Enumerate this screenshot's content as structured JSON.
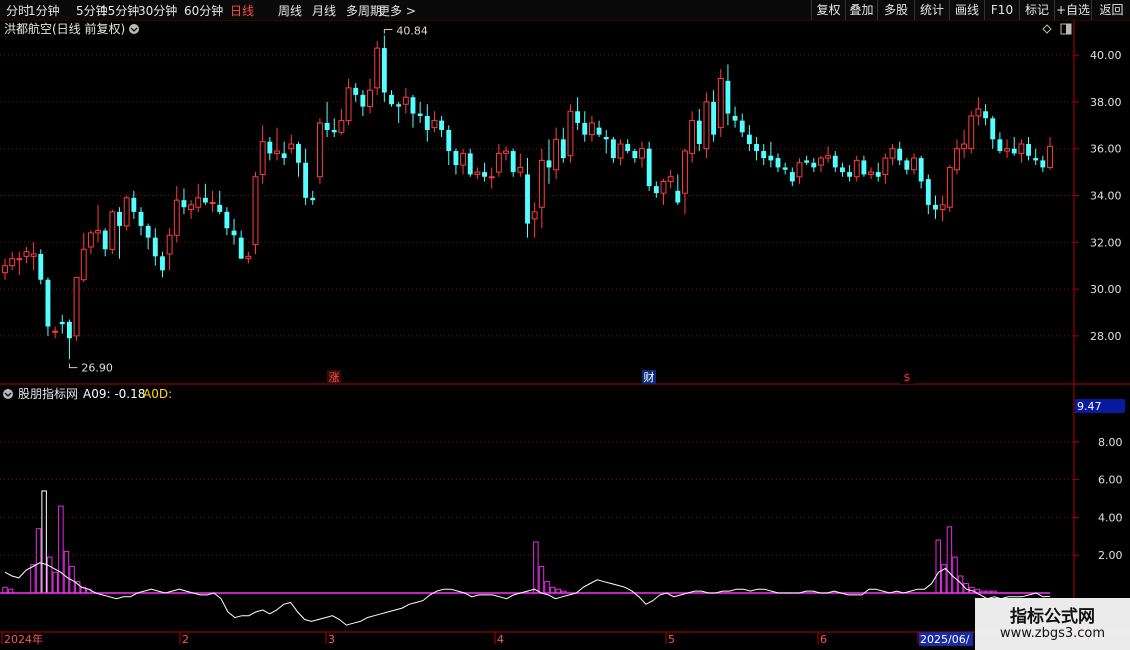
{
  "toolbar": {
    "periods": [
      "分时",
      "1分钟",
      "5分钟",
      "15分钟",
      "30分钟",
      "60分钟",
      "日线",
      "周线",
      "月线",
      "多周期",
      "更多 >"
    ],
    "active_period": "日线",
    "right_buttons": [
      "复权",
      "叠加",
      "多股",
      "统计",
      "画线",
      "F10",
      "标记",
      "+自选",
      "返回"
    ]
  },
  "chart_title": "洪都航空(日线 前复权)",
  "indicator_title": "股朋指标网",
  "indicator_readout_a09": "A09: -0.18",
  "indicator_readout_a0d": "A0D:",
  "indicator_current_label": "9.47",
  "price_max_label": "40.84",
  "price_min_label": "26.90",
  "events": {
    "zhang": "涨",
    "cai": "财",
    "dollar": "$"
  },
  "x_labels": [
    "2024年",
    "2",
    "3",
    "4",
    "5",
    "6",
    "2025/06/"
  ],
  "watermark": {
    "line1": "指标公式网",
    "line2": "www.zbgs3.com"
  },
  "colors": {
    "up": "#ff3c3c",
    "down": "#54ffff",
    "grid": "#7a1010",
    "axis": "#b40000",
    "line": "#ffffff",
    "bars": "#e030e0",
    "baseline": "#ff30ff"
  },
  "chart_data": [
    {
      "type": "candlestick",
      "title": "洪都航空(日线 前复权)",
      "y_ticks": [
        28,
        30,
        32,
        34,
        36,
        38,
        40
      ],
      "ylim": [
        27,
        41.5
      ],
      "max_label": 40.84,
      "min_label": 26.9,
      "candles": [
        [
          30.7,
          31.3,
          30.4,
          31.0
        ],
        [
          31.0,
          31.6,
          30.8,
          31.3
        ],
        [
          31.3,
          31.6,
          30.6,
          31.3
        ],
        [
          31.4,
          31.8,
          31.1,
          31.6
        ],
        [
          31.4,
          32.0,
          30.8,
          31.5
        ],
        [
          31.5,
          31.7,
          30.2,
          30.4
        ],
        [
          30.4,
          30.5,
          28.0,
          28.4
        ],
        [
          28.2,
          28.4,
          27.9,
          28.2
        ],
        [
          28.6,
          28.9,
          28.1,
          28.5
        ],
        [
          28.6,
          28.7,
          27.0,
          27.9
        ],
        [
          28.0,
          30.5,
          27.8,
          30.5
        ],
        [
          30.4,
          32.4,
          30.3,
          31.7
        ],
        [
          31.8,
          32.5,
          31.5,
          32.4
        ],
        [
          32.4,
          33.6,
          32.0,
          32.5
        ],
        [
          32.5,
          32.6,
          31.4,
          31.7
        ],
        [
          31.7,
          33.4,
          31.5,
          33.3
        ],
        [
          33.3,
          33.5,
          31.3,
          32.7
        ],
        [
          32.7,
          34.0,
          32.5,
          33.9
        ],
        [
          33.9,
          34.2,
          33.0,
          33.3
        ],
        [
          33.3,
          33.5,
          32.3,
          32.7
        ],
        [
          32.7,
          32.8,
          31.7,
          32.2
        ],
        [
          32.2,
          32.6,
          31.0,
          31.4
        ],
        [
          31.4,
          31.6,
          30.5,
          30.8
        ],
        [
          31.5,
          32.6,
          30.8,
          32.3
        ],
        [
          32.3,
          34.4,
          32.0,
          33.8
        ],
        [
          33.8,
          34.3,
          33.2,
          33.5
        ],
        [
          33.4,
          33.8,
          33.0,
          33.6
        ],
        [
          33.5,
          34.5,
          33.3,
          33.9
        ],
        [
          33.9,
          34.5,
          33.6,
          33.7
        ],
        [
          33.7,
          34.2,
          33.3,
          33.7
        ],
        [
          33.6,
          34.2,
          33.2,
          33.3
        ],
        [
          33.3,
          33.5,
          32.3,
          32.6
        ],
        [
          32.5,
          33.0,
          31.9,
          32.3
        ],
        [
          32.2,
          32.5,
          31.3,
          31.3
        ],
        [
          31.3,
          31.6,
          31.1,
          31.4
        ],
        [
          31.9,
          35.0,
          31.5,
          34.8
        ],
        [
          34.9,
          37.0,
          34.5,
          36.3
        ],
        [
          36.3,
          36.5,
          35.5,
          35.8
        ],
        [
          35.8,
          36.9,
          35.5,
          35.9
        ],
        [
          35.8,
          36.3,
          35.3,
          35.6
        ],
        [
          36.0,
          36.6,
          35.8,
          36.2
        ],
        [
          36.2,
          36.3,
          34.8,
          35.4
        ],
        [
          35.4,
          36.0,
          33.6,
          33.9
        ],
        [
          33.9,
          34.2,
          33.6,
          33.8
        ],
        [
          34.8,
          37.3,
          34.5,
          37.1
        ],
        [
          37.1,
          38.0,
          36.5,
          36.8
        ],
        [
          36.8,
          37.3,
          36.5,
          36.7
        ],
        [
          36.7,
          37.7,
          36.6,
          37.2
        ],
        [
          37.2,
          39.0,
          37.0,
          38.6
        ],
        [
          38.6,
          38.8,
          38.0,
          38.3
        ],
        [
          38.3,
          38.5,
          37.4,
          37.8
        ],
        [
          37.8,
          39.0,
          37.5,
          38.5
        ],
        [
          38.6,
          40.6,
          38.3,
          40.3
        ],
        [
          40.3,
          40.84,
          38.0,
          38.4
        ],
        [
          38.3,
          38.5,
          37.8,
          37.9
        ],
        [
          37.9,
          38.0,
          37.1,
          37.8
        ],
        [
          37.9,
          38.6,
          37.5,
          38.2
        ],
        [
          38.2,
          38.3,
          36.9,
          37.5
        ],
        [
          37.5,
          38.0,
          37.1,
          37.4
        ],
        [
          37.4,
          37.9,
          36.3,
          36.8
        ],
        [
          36.9,
          37.6,
          36.7,
          37.2
        ],
        [
          37.2,
          37.4,
          36.5,
          36.8
        ],
        [
          36.8,
          37.0,
          35.3,
          35.9
        ],
        [
          35.9,
          36.0,
          34.9,
          35.3
        ],
        [
          35.3,
          36.0,
          34.9,
          35.8
        ],
        [
          35.8,
          36.0,
          34.8,
          34.9
        ],
        [
          34.9,
          35.2,
          34.7,
          35.0
        ],
        [
          35.0,
          35.4,
          34.6,
          34.8
        ],
        [
          34.8,
          35.2,
          34.3,
          34.8
        ],
        [
          35.0,
          36.2,
          34.8,
          35.8
        ],
        [
          35.8,
          36.1,
          35.5,
          35.9
        ],
        [
          35.9,
          36.0,
          34.8,
          35.0
        ],
        [
          35.0,
          35.8,
          34.8,
          35.2
        ],
        [
          34.9,
          35.6,
          32.2,
          32.8
        ],
        [
          33.0,
          33.7,
          32.2,
          33.3
        ],
        [
          33.5,
          36.0,
          32.6,
          35.5
        ],
        [
          35.5,
          36.4,
          34.5,
          35.2
        ],
        [
          35.1,
          36.9,
          34.7,
          36.4
        ],
        [
          36.4,
          36.9,
          35.4,
          35.6
        ],
        [
          35.7,
          37.9,
          35.4,
          37.6
        ],
        [
          37.6,
          38.2,
          36.8,
          37.1
        ],
        [
          37.1,
          37.6,
          36.3,
          36.6
        ],
        [
          36.6,
          37.4,
          36.3,
          37.1
        ],
        [
          36.9,
          37.2,
          36.5,
          36.6
        ],
        [
          36.5,
          36.8,
          35.8,
          36.4
        ],
        [
          36.4,
          36.5,
          35.4,
          35.6
        ],
        [
          35.6,
          36.4,
          35.3,
          36.2
        ],
        [
          36.2,
          36.4,
          35.8,
          35.9
        ],
        [
          35.9,
          36.0,
          35.4,
          35.6
        ],
        [
          35.6,
          36.3,
          35.2,
          36.0
        ],
        [
          36.0,
          36.3,
          34.2,
          34.4
        ],
        [
          34.4,
          34.6,
          33.9,
          34.1
        ],
        [
          34.1,
          34.7,
          33.6,
          34.6
        ],
        [
          34.6,
          35.1,
          34.3,
          34.8
        ],
        [
          34.2,
          34.9,
          33.6,
          33.7
        ],
        [
          34.1,
          36.0,
          33.2,
          35.9
        ],
        [
          35.8,
          37.6,
          35.4,
          37.2
        ],
        [
          37.2,
          37.7,
          35.9,
          36.2
        ],
        [
          36.0,
          38.4,
          35.6,
          38.0
        ],
        [
          38.0,
          38.5,
          36.3,
          36.6
        ],
        [
          36.9,
          39.4,
          36.5,
          39.0
        ],
        [
          38.9,
          39.6,
          37.0,
          37.5
        ],
        [
          37.4,
          37.8,
          36.9,
          37.2
        ],
        [
          37.2,
          37.5,
          36.5,
          36.7
        ],
        [
          36.6,
          37.0,
          35.9,
          36.2
        ],
        [
          36.2,
          36.5,
          35.5,
          35.9
        ],
        [
          35.9,
          36.2,
          35.3,
          35.6
        ],
        [
          35.7,
          36.3,
          35.2,
          35.5
        ],
        [
          35.6,
          35.8,
          35.0,
          35.2
        ],
        [
          35.2,
          35.4,
          34.9,
          35.1
        ],
        [
          35.0,
          35.2,
          34.4,
          34.6
        ],
        [
          34.8,
          35.6,
          34.5,
          35.4
        ],
        [
          35.5,
          35.7,
          35.3,
          35.4
        ],
        [
          35.4,
          35.6,
          35.0,
          35.2
        ],
        [
          35.3,
          35.7,
          35.0,
          35.6
        ],
        [
          35.6,
          36.1,
          35.4,
          35.7
        ],
        [
          35.7,
          35.9,
          35.0,
          35.2
        ],
        [
          35.2,
          35.4,
          34.8,
          35.0
        ],
        [
          35.0,
          35.3,
          34.6,
          34.8
        ],
        [
          34.8,
          35.7,
          34.6,
          35.5
        ],
        [
          35.5,
          35.7,
          34.8,
          34.9
        ],
        [
          34.9,
          35.2,
          34.7,
          35.0
        ],
        [
          35.0,
          35.4,
          34.6,
          34.8
        ],
        [
          34.9,
          35.8,
          34.5,
          35.6
        ],
        [
          35.6,
          36.2,
          35.3,
          36.0
        ],
        [
          36.0,
          36.3,
          35.3,
          35.5
        ],
        [
          35.5,
          35.6,
          34.9,
          35.1
        ],
        [
          35.1,
          35.8,
          34.9,
          35.6
        ],
        [
          35.6,
          35.7,
          34.3,
          34.6
        ],
        [
          34.7,
          34.9,
          33.2,
          33.6
        ],
        [
          33.6,
          34.0,
          33.0,
          33.4
        ],
        [
          33.4,
          34.0,
          32.9,
          33.6
        ],
        [
          33.5,
          35.3,
          33.3,
          35.2
        ],
        [
          35.1,
          36.4,
          34.9,
          36.0
        ],
        [
          36.0,
          36.8,
          35.6,
          36.2
        ],
        [
          36.0,
          37.6,
          35.8,
          37.4
        ],
        [
          37.4,
          38.2,
          37.0,
          37.7
        ],
        [
          37.6,
          37.9,
          37.0,
          37.3
        ],
        [
          37.3,
          37.4,
          36.0,
          36.4
        ],
        [
          36.4,
          36.7,
          35.8,
          35.9
        ],
        [
          35.9,
          36.4,
          35.6,
          36.0
        ],
        [
          36.0,
          36.5,
          35.7,
          35.8
        ],
        [
          35.8,
          36.4,
          35.4,
          36.2
        ],
        [
          36.2,
          36.5,
          35.5,
          35.7
        ],
        [
          35.6,
          36.0,
          35.3,
          35.5
        ],
        [
          35.5,
          35.7,
          35.0,
          35.2
        ],
        [
          35.2,
          36.5,
          35.1,
          36.1
        ]
      ]
    },
    {
      "type": "bar+line",
      "title": "股朋指标网",
      "y_ticks": [
        2.0,
        4.0,
        6.0,
        8.0
      ],
      "ylim": [
        0,
        10.2
      ],
      "baseline": 0,
      "series": [
        {
          "name": "A09",
          "type": "line",
          "values": [
            1.1,
            0.9,
            0.8,
            1.2,
            1.4,
            1.6,
            1.5,
            1.3,
            1.1,
            0.8,
            0.6,
            0.3,
            0.2,
            0.0,
            -0.1,
            -0.2,
            -0.3,
            -0.2,
            -0.2,
            0.0,
            0.1,
            0.2,
            0.1,
            0.0,
            0.1,
            0.2,
            0.1,
            0.0,
            -0.1,
            -0.1,
            0.0,
            -0.3,
            -1.0,
            -1.3,
            -1.2,
            -1.2,
            -1.0,
            -0.9,
            -1.1,
            -0.9,
            -0.6,
            -0.5,
            -1.0,
            -1.4,
            -1.5,
            -1.4,
            -1.3,
            -1.2,
            -1.4,
            -1.7,
            -1.6,
            -1.5,
            -1.3,
            -1.2,
            -1.1,
            -1.0,
            -0.9,
            -0.8,
            -0.6,
            -0.5,
            -0.4,
            -0.1,
            0.1,
            0.2,
            0.2,
            0.1,
            0.0,
            -0.2,
            -0.1,
            -0.1,
            -0.1,
            -0.2,
            -0.3,
            -0.1,
            0.0,
            0.1,
            0.2,
            0.0,
            -0.1,
            -0.3,
            -0.2,
            -0.1,
            0.0,
            0.3,
            0.5,
            0.7,
            0.6,
            0.5,
            0.4,
            0.3,
            0.1,
            -0.2,
            -0.6,
            -0.4,
            -0.1,
            0.0,
            -0.2,
            -0.1,
            0.0,
            0.1,
            0.1,
            0.0,
            0.0,
            0.1,
            0.1,
            0.2,
            0.2,
            0.1,
            0.2,
            0.2,
            0.1,
            0.0,
            0.0,
            0.0,
            0.0,
            0.1,
            0.1,
            0.0,
            0.0,
            0.1,
            0.0,
            -0.1,
            -0.1,
            -0.1,
            0.2,
            0.2,
            0.1,
            0.0,
            0.1,
            0.0,
            0.1,
            0.2,
            0.2,
            0.5,
            1.1,
            1.3,
            0.9,
            0.6,
            0.2,
            0.1,
            -0.1,
            -0.3,
            -0.2,
            -0.3,
            -0.2,
            -0.2,
            -0.2,
            -0.1,
            0.0,
            -0.2,
            -0.18
          ]
        },
        {
          "name": "A0D",
          "type": "bar",
          "values": [
            0.3,
            0.2,
            0,
            0,
            0,
            1.5,
            3.4,
            5.4,
            1.9,
            1.1,
            4.6,
            2.2,
            1.4,
            0.6,
            0.3,
            0.2,
            0,
            0,
            0,
            0,
            0,
            0,
            0,
            0,
            0,
            0,
            0,
            0,
            0,
            0,
            0,
            0,
            0,
            0,
            0,
            0,
            0,
            0,
            0,
            0,
            0,
            0,
            0,
            0,
            0,
            0,
            0,
            0,
            0,
            0,
            0,
            0,
            0,
            0,
            0,
            0,
            0,
            0,
            0,
            0,
            0,
            0,
            0,
            0,
            0,
            0,
            0,
            0,
            0,
            0,
            0,
            0,
            0,
            0,
            0,
            0,
            0,
            0,
            0,
            0,
            0,
            0,
            0,
            0,
            0,
            0,
            0,
            0,
            0,
            0,
            0,
            0,
            0,
            0,
            0,
            2.7,
            1.4,
            0.6,
            0.3,
            0.2,
            0.1,
            0,
            0,
            0,
            0,
            0,
            0,
            0,
            0,
            0,
            0,
            0,
            0,
            0,
            0,
            0,
            0,
            0,
            0,
            0,
            0,
            0,
            0,
            0,
            0,
            0,
            0,
            0,
            0,
            0,
            0,
            0,
            0,
            0,
            0,
            0,
            0,
            0,
            0,
            0,
            0,
            0,
            0,
            0,
            0,
            0,
            0,
            0,
            0,
            0,
            0,
            0,
            0,
            0,
            0,
            0,
            0,
            0,
            0,
            0,
            0,
            0,
            0,
            0,
            0,
            0,
            0,
            2.8,
            1.5,
            3.5,
            1.9,
            0.9,
            0.5,
            0.3,
            0.2,
            0.1,
            0.1,
            0.1,
            0,
            0,
            0,
            0,
            0,
            0,
            0,
            0,
            0,
            0
          ]
        }
      ]
    }
  ]
}
